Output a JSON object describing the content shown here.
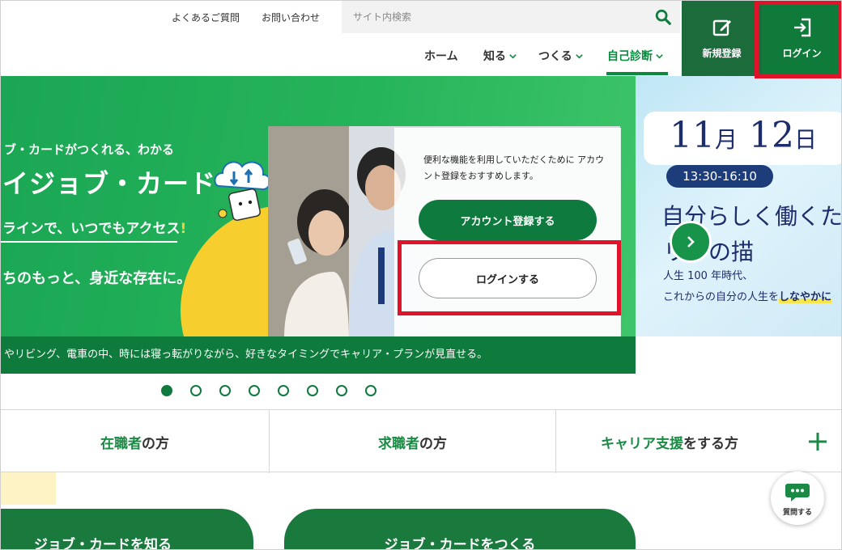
{
  "header": {
    "faq": "よくあるご質問",
    "contact": "お問い合わせ",
    "search_placeholder": "サイト内検索",
    "nav": [
      {
        "label": "ホーム"
      },
      {
        "label": "知る"
      },
      {
        "label": "つくる"
      },
      {
        "label": "自己診断"
      }
    ],
    "register_label": "新規登録",
    "login_label": "ログイン"
  },
  "hero": {
    "line1": "ブ・カードがつくれる、わかる",
    "line2": "イジョブ・カード",
    "line3": "ラインで、いつでもアクセス",
    "line3_excl": "!",
    "line4": "ちのもっと、身近な存在に。",
    "strip": "やリビング、電車の中、時には寝っ転がりながら、好きなタイミングでキャリア・プランが見直せる。",
    "panel_text": "便利な機能を利用していただくために アカウント登録をおすすめします。",
    "register_button": "アカウント登録する",
    "login_button": "ログインする"
  },
  "slide2": {
    "date_num1": "11",
    "date_unit1": "月",
    "date_num2": "12",
    "date_unit2": "日",
    "time": "13:30-16:10",
    "headline": "自分らしく働くた",
    "subline": "リアの描",
    "line1": "人生 100 年時代、",
    "line2_pre": "これからの自分の人生を",
    "line2_em": "しなやかに"
  },
  "carousel": {
    "count": 8,
    "active_index": 0
  },
  "tabs": [
    {
      "green": "在職者",
      "rest": "の方"
    },
    {
      "green": "求職者",
      "rest": "の方"
    },
    {
      "green": "キャリア支援",
      "rest": "をする方"
    }
  ],
  "cards": [
    {
      "label": "ジョブ・カードを知る"
    },
    {
      "label": "ジョブ・カードをつくる"
    }
  ],
  "help_label": "質問する",
  "colors": {
    "brand_green": "#0f7a3d",
    "highlight_red": "#e0132b",
    "accent_yellow": "#f6cf2e"
  }
}
